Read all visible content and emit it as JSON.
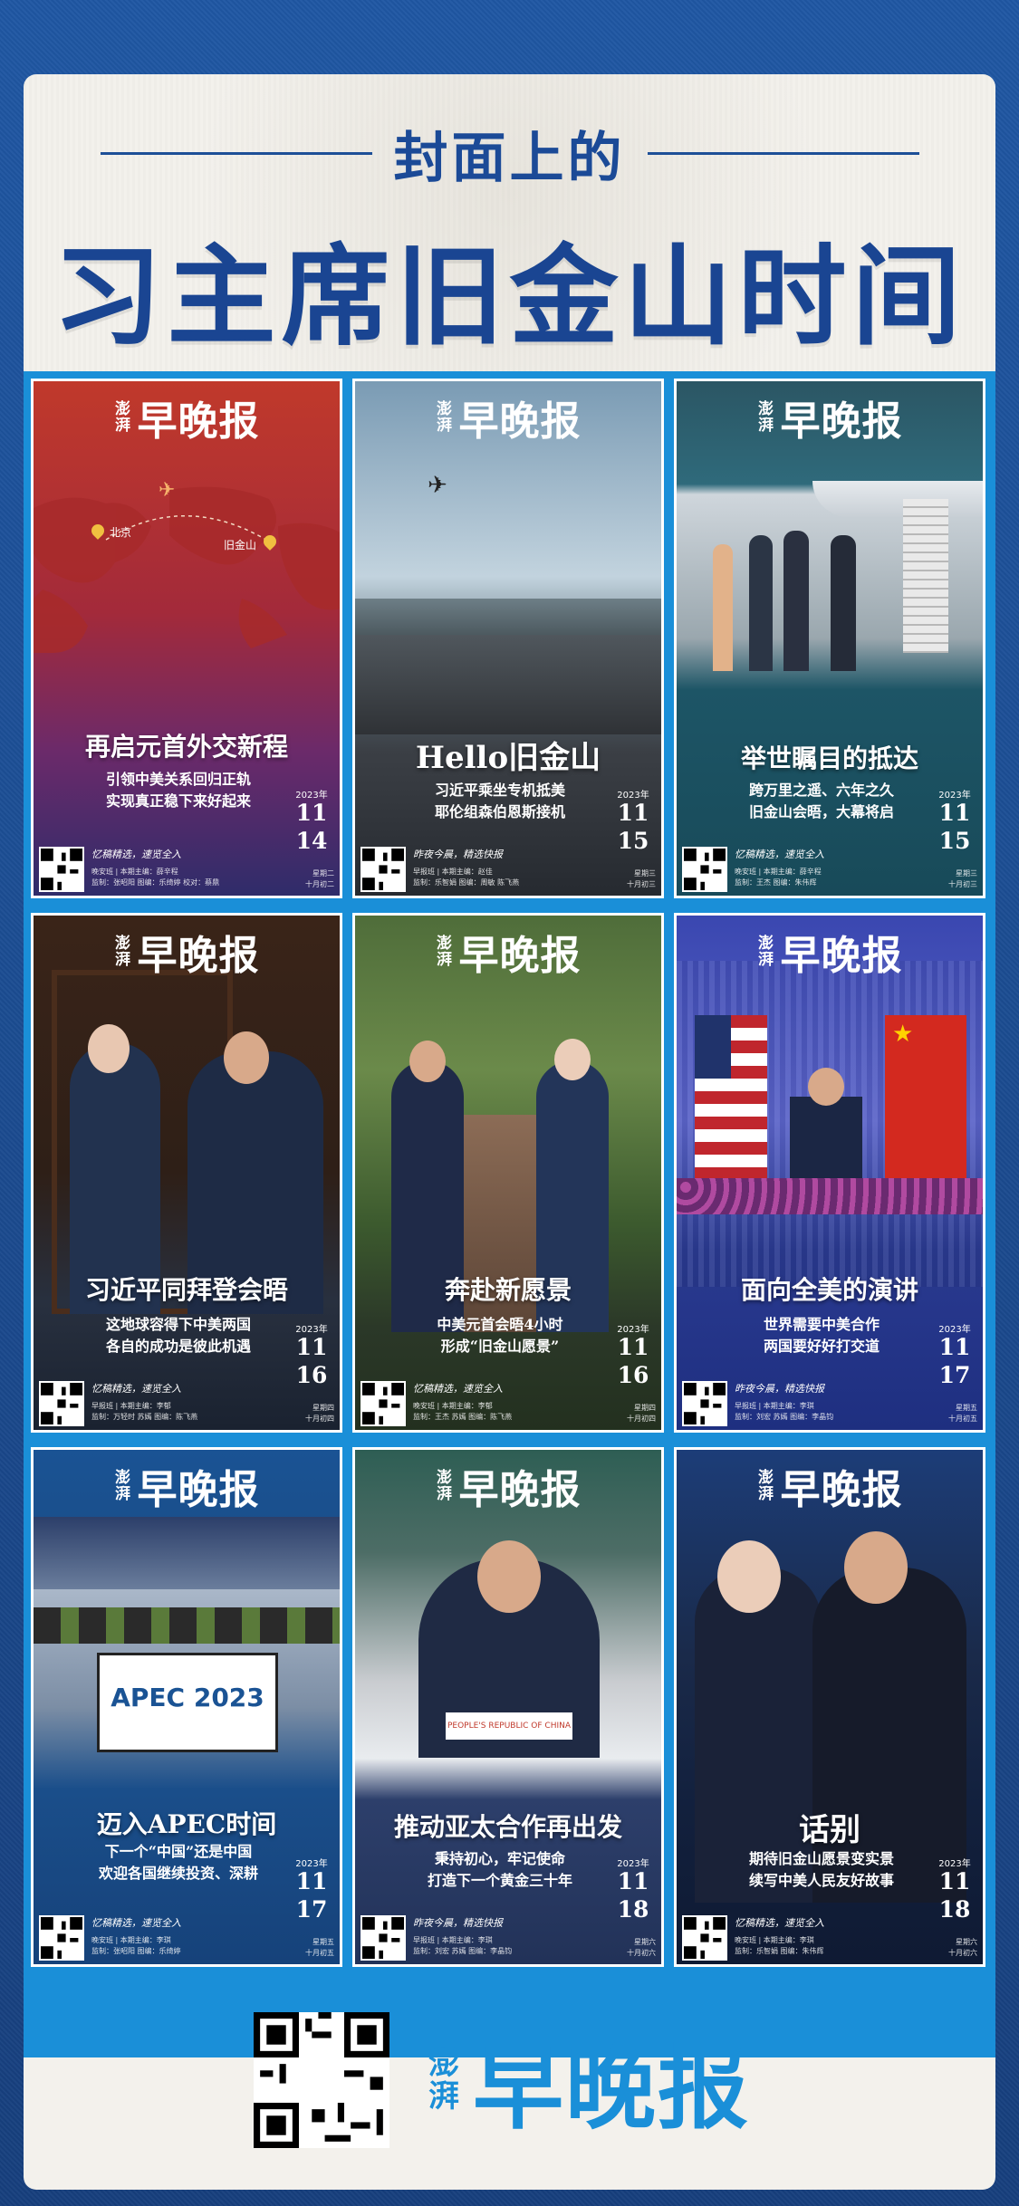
{
  "header": {
    "subtitle": "封面上的",
    "title": "习主席旧金山时间"
  },
  "brand": {
    "small": "澎湃",
    "name": "早晚报",
    "color": "#1a8fd8"
  },
  "covers": [
    {
      "headline": "再启元首外交新程",
      "blurb": "引领中美关系回归正轨\n实现真正稳下来好起来",
      "map_labels": [
        "北京",
        "旧金山"
      ],
      "year": "2023年",
      "month": "11",
      "day": "14",
      "slogan": "忆稿精选，速览全入",
      "credits": "晚安班 | 本期主编：薛辛程\n监制：张昭阳 图编：乐绮婷 校对：蔡鼎",
      "weekday": "星期二\n十月初二",
      "theme": "#c0392b"
    },
    {
      "headline": "Hello旧金山",
      "blurb": "习近平乘坐专机抵美\n耶伦组森伯恩斯接机",
      "year": "2023年",
      "month": "11",
      "day": "15",
      "slogan": "昨夜今晨，精选快报",
      "credits": "早报班 | 本期主编：赵佳\n监制：乐智娟 图编：周敏 陈飞燕",
      "weekday": "星期三\n十月初三",
      "theme": "#3d4a55"
    },
    {
      "headline": "举世瞩目的抵达",
      "blurb": "跨万里之遥、六年之久\n旧金山会晤，大幕将启",
      "year": "2023年",
      "month": "11",
      "day": "15",
      "slogan": "忆稿精选，速览全入",
      "credits": "晚安班 | 本期主编：薛辛程\n监制：王杰 图编：朱伟辉",
      "weekday": "星期三\n十月初三",
      "theme": "#1f5768"
    },
    {
      "headline": "习近平同拜登会晤",
      "blurb": "这地球容得下中美两国\n各自的成功是彼此机遇",
      "year": "2023年",
      "month": "11",
      "day": "16",
      "slogan": "忆稿精选，速览全入",
      "credits": "早报班 | 本期主编：李郁\n监制：万轻时 苏嫣 图编：陈飞燕",
      "weekday": "星期四\n十月初四",
      "theme": "#2c2018"
    },
    {
      "headline": "奔赴新愿景",
      "blurb": "中美元首会晤4小时\n形成“旧金山愿景”",
      "year": "2023年",
      "month": "11",
      "day": "16",
      "slogan": "忆稿精选，速览全入",
      "credits": "晚安班 | 本期主编：李郁\n监制：王杰 苏嫣 图编：陈飞燕",
      "weekday": "星期四\n十月初四",
      "theme": "#3c5a2e"
    },
    {
      "headline": "面向全美的演讲",
      "blurb": "世界需要中美合作\n两国要好好打交道",
      "year": "2023年",
      "month": "11",
      "day": "17",
      "slogan": "昨夜今晨，精选快报",
      "credits": "早报班 | 本期主编：李琪\n监制：刘宏 苏嫣 图编：李晶钧",
      "weekday": "星期五\n十月初五",
      "theme": "#1e3d8f"
    },
    {
      "headline": "迈入APEC时间",
      "blurb": "下一个“中国”还是中国\n欢迎各国继续投资、深耕",
      "screen_text": "APEC 2023",
      "year": "2023年",
      "month": "11",
      "day": "17",
      "slogan": "忆稿精选，速览全入",
      "credits": "晚安班 | 本期主编：李琪\n监制：张昭阳 图编：乐绮婷",
      "weekday": "星期五\n十月初五",
      "theme": "#1a4e8a"
    },
    {
      "headline": "推动亚太合作再出发",
      "blurb": "秉持初心，牢记使命\n打造下一个黄金三十年",
      "placard": "PEOPLE'S REPUBLIC OF CHINA",
      "year": "2023年",
      "month": "11",
      "day": "18",
      "slogan": "昨夜今晨，精选快报",
      "credits": "早报班 | 本期主编：李琪\n监制：刘宏 苏嫣 图编：李晶钧",
      "weekday": "星期六\n十月初六",
      "theme": "#2d3f6b"
    },
    {
      "headline": "话别",
      "blurb": "期待旧金山愿景变实景\n续写中美人民友好故事",
      "year": "2023年",
      "month": "11",
      "day": "18",
      "slogan": "忆稿精选，速览全入",
      "credits": "晚安班 | 本期主编：李琪\n监制：乐智娟 图编：朱伟辉",
      "weekday": "星期六\n十月初六",
      "theme": "#1c3d78"
    }
  ]
}
